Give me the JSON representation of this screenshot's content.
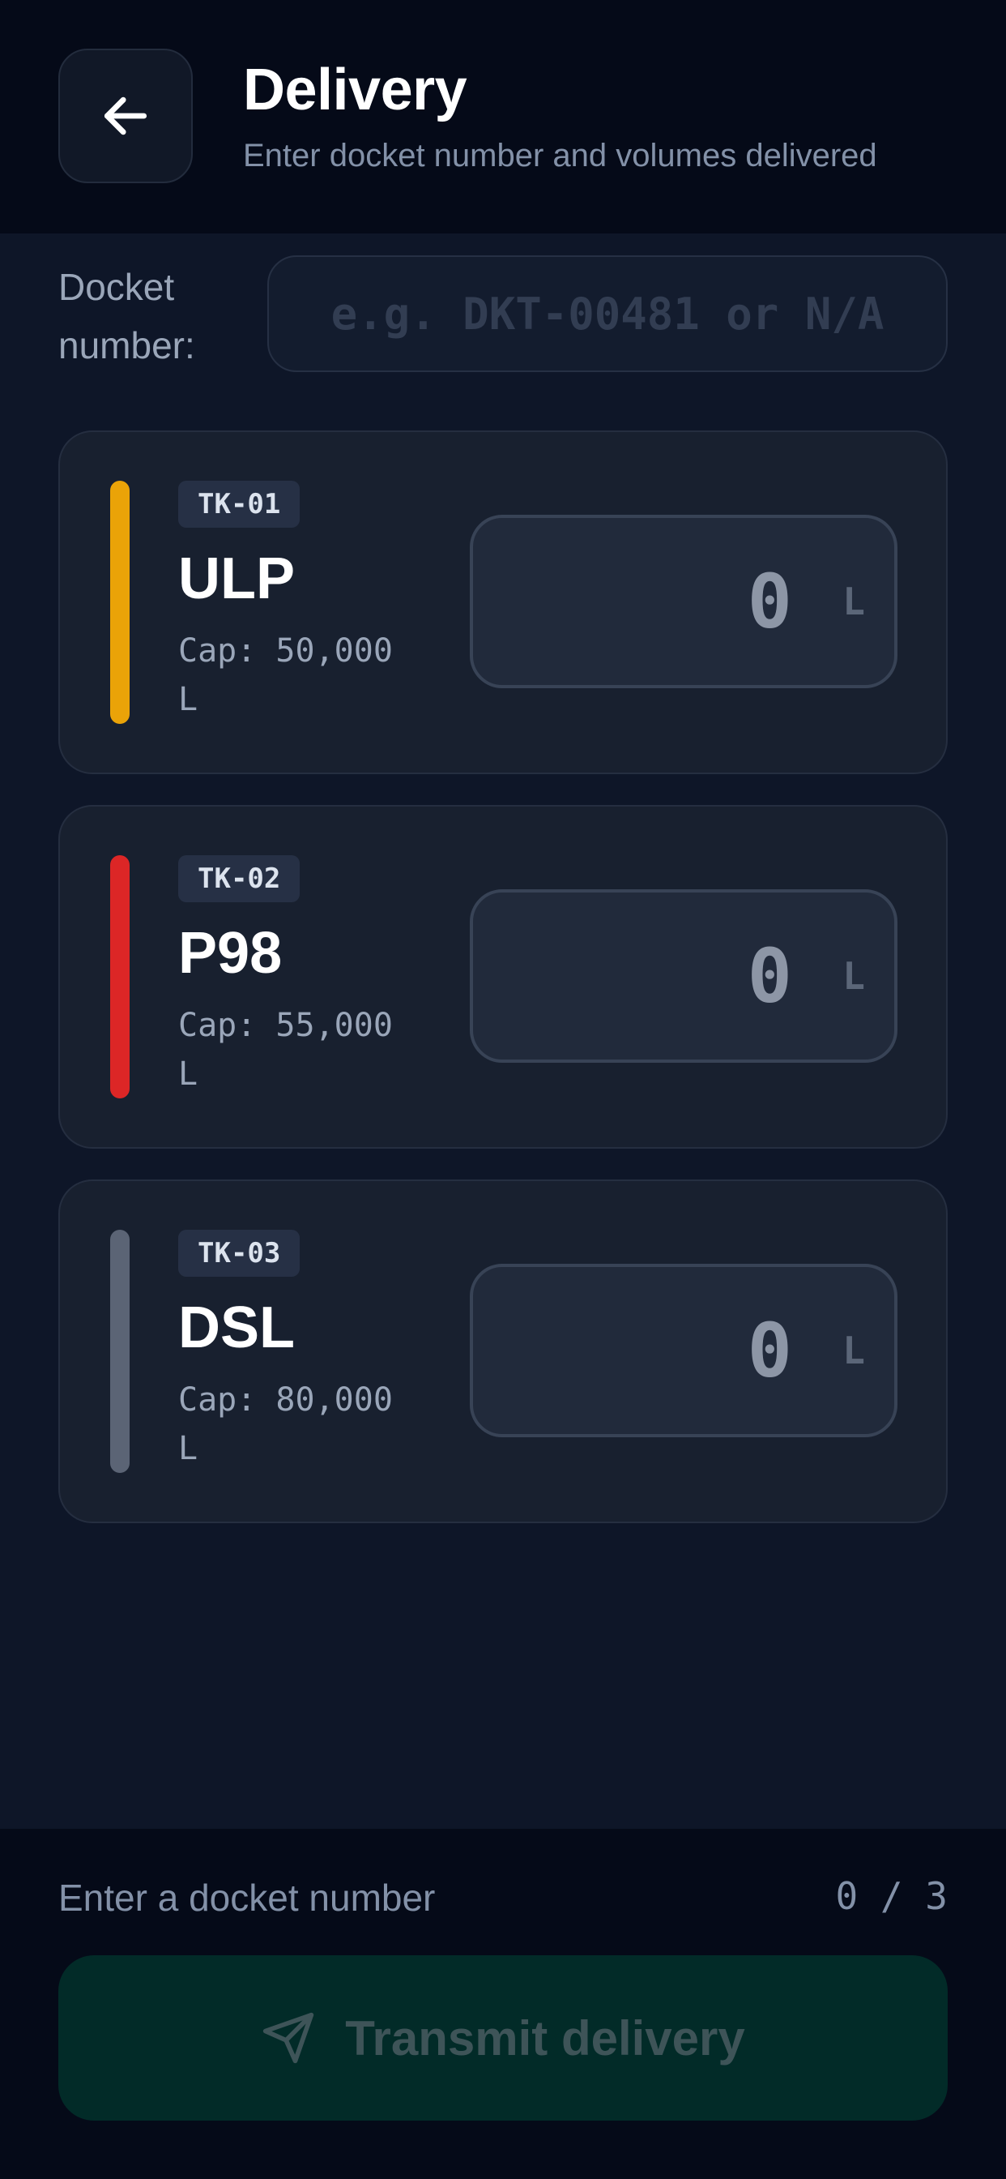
{
  "header": {
    "title": "Delivery",
    "subtitle": "Enter docket number and volumes delivered",
    "back_icon": "arrow-left-icon"
  },
  "docket": {
    "label": "Docket number:",
    "placeholder": "e.g. DKT-00481 or N/A",
    "value": ""
  },
  "tanks": [
    {
      "id": "TK-01",
      "name": "ULP",
      "capacity": "Cap: 50,000 L",
      "value": "0",
      "unit": "L",
      "color": "#eaa308"
    },
    {
      "id": "TK-02",
      "name": "P98",
      "capacity": "Cap: 55,000 L",
      "value": "0",
      "unit": "L",
      "color": "#dc2626"
    },
    {
      "id": "TK-03",
      "name": "DSL",
      "capacity": "Cap: 80,000 L",
      "value": "0",
      "unit": "L",
      "color": "#5b6475"
    }
  ],
  "footer": {
    "hint": "Enter a docket number",
    "count": "0 / 3",
    "transmit_label": "Transmit delivery",
    "transmit_icon": "send-icon"
  },
  "colors": {
    "background": "#0e1628",
    "header_bg": "#050a18",
    "card_bg": "#18202f",
    "button_disabled_bg": "#022b28"
  }
}
